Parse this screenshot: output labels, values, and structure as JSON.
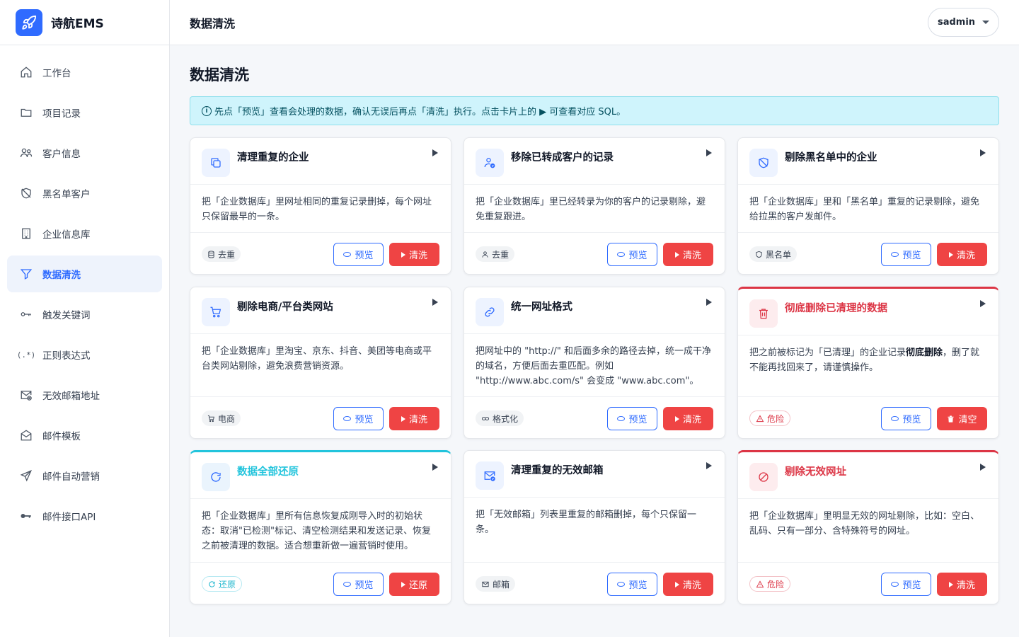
{
  "brand": {
    "name": "诗航EMS"
  },
  "sidebar": {
    "items": [
      {
        "label": "工作台",
        "icon": "home-icon"
      },
      {
        "label": "项目记录",
        "icon": "folder-icon"
      },
      {
        "label": "客户信息",
        "icon": "users-icon"
      },
      {
        "label": "黑名单客户",
        "icon": "shield-slash-icon"
      },
      {
        "label": "企业信息库",
        "icon": "building-icon"
      },
      {
        "label": "数据清洗",
        "icon": "filter-icon",
        "active": true
      },
      {
        "label": "触发关键词",
        "icon": "key-icon"
      },
      {
        "label": "正则表达式",
        "icon": "regex-icon",
        "glyph": "(.*)"
      },
      {
        "label": "无效邮箱地址",
        "icon": "mail-x-icon"
      },
      {
        "label": "邮件模板",
        "icon": "mail-open-icon"
      },
      {
        "label": "邮件自动营销",
        "icon": "send-icon"
      },
      {
        "label": "邮件接口API",
        "icon": "key-fill-icon"
      }
    ]
  },
  "header": {
    "title": "数据清洗",
    "user": "sadmin"
  },
  "main": {
    "title": "数据清洗",
    "info": "先点「预览」查看会处理的数据，确认无误后再点「清洗」执行。点击卡片上的 ▶ 可查看对应 SQL。"
  },
  "cards": [
    {
      "title": "清理重复的企业",
      "desc": "把「企业数据库」里网址相同的重复记录删掉，每个网址只保留最早的一条。",
      "tag": "去重",
      "preview": "预览",
      "action": "清洗"
    },
    {
      "title": "移除已转成客户的记录",
      "desc": "把「企业数据库」里已经转录为你的客户的记录剔除，避免重复跟进。",
      "tag": "去重",
      "preview": "预览",
      "action": "清洗"
    },
    {
      "title": "剔除黑名单中的企业",
      "desc": "把「企业数据库」里和「黑名单」重复的记录剔除，避免给拉黑的客户发邮件。",
      "tag": "黑名单",
      "preview": "预览",
      "action": "清洗"
    },
    {
      "title": "剔除电商/平台类网站",
      "desc": "把「企业数据库」里淘宝、京东、抖音、美团等电商或平台类网站剔除，避免浪费营销资源。",
      "tag": "电商",
      "preview": "预览",
      "action": "清洗"
    },
    {
      "title": "统一网址格式",
      "desc": "把网址中的 \"http://\" 和后面多余的路径去掉，统一成干净的域名，方便后面去重匹配。例如 \"http://www.abc.com/s\" 会变成 \"www.abc.com\"。",
      "tag": "格式化",
      "preview": "预览",
      "action": "清洗"
    },
    {
      "title": "彻底删除已清理的数据",
      "desc_pre": "把之前被标记为「已清理」的企业记录",
      "desc_bold": "彻底删除",
      "desc_post": "，删了就不能再找回来了，请谨慎操作。",
      "tag": "危险",
      "preview": "预览",
      "action": "清空"
    },
    {
      "title": "数据全部还原",
      "desc": "把「企业数据库」里所有信息恢复成刚导入时的初始状态：取消\"已检测\"标记、清空检测结果和发送记录、恢复之前被清理的数据。适合想重新做一遍营销时使用。",
      "tag": "还原",
      "preview": "预览",
      "action": "还原"
    },
    {
      "title": "清理重复的无效邮箱",
      "desc": "把「无效邮箱」列表里重复的邮箱删掉，每个只保留一条。",
      "tag": "邮箱",
      "preview": "预览",
      "action": "清洗"
    },
    {
      "title": "剔除无效网址",
      "desc": "把「企业数据库」里明显无效的网址剔除，比如：空白、乱码、只有一部分、含特殊符号的网址。",
      "tag": "危险",
      "preview": "预览",
      "action": "清洗"
    }
  ],
  "colors": {
    "primary": "#2f6bff",
    "danger": "#ef4444",
    "danger_title": "#dc3545",
    "cyan": "#22c4dc",
    "info_bg": "#cff4fc"
  }
}
